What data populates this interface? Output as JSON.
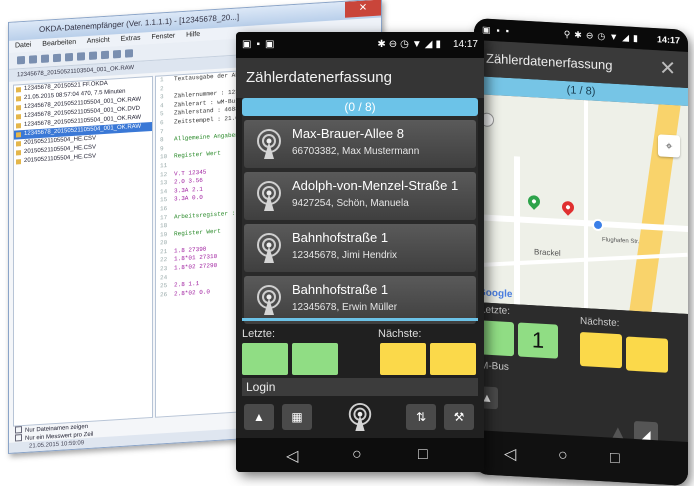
{
  "desktop_window": {
    "title": "OKDA-Datenempfänger (Ver. 1.1.1.1) - [12345678_20...]",
    "close_label": "✕",
    "menu": [
      "Datei",
      "Bearbeiten",
      "Ansicht",
      "Extras",
      "Fenster",
      "Hilfe"
    ],
    "tab_label": "12345678_20150521103504_001_OK.RAW",
    "tree_items": [
      "12345678_20150521 FF.OKDA",
      "21.05.2015 08:57:04 470, 7.5 Minuten",
      "12345678_20150521105504_001_OK.RAW",
      "12345678_20150521105504_001_OK.DVD",
      "12345678_20150521105504_001_OK.RAW",
      "12345678_20150521105504_001_OK.RAW",
      "20150521105504_HE.CSV",
      "20150521105504_HE.CSV",
      "20150521105504_HE.CSV"
    ],
    "selected_index": 5,
    "text_lines": [
      "Textausgabe der Ablesewerte",
      "",
      "Zählernummer : 12345678",
      "Zählerart    : wM-Bus",
      "Zählerstand  : 46880",
      "Zeitstempel  : 21.05.15",
      "",
      "Allgemeine Angaben :",
      "",
      "Register     Wert",
      "",
      "V.T          12345",
      "2.0          3.56",
      "3.3A         2.1",
      "3.3A         0.0",
      "",
      "Arbeitsregister :",
      "",
      "Register     Wert",
      "",
      "1.8          27390",
      "1.8*01       27310",
      "1.8*02       27290",
      "",
      "2.8          1.1",
      "2.8*02       0.0"
    ],
    "checkboxes": [
      "Nur Dateinamen zeigen",
      "Nur ein Messwert pro Zeil"
    ],
    "status_text": "21.05.2015   10:59:09"
  },
  "phone_list": {
    "status_time": "14:17",
    "title": "Zählerdatenerfassung",
    "counter": "(0 / 8)",
    "items": [
      {
        "street": "Max-Brauer-Allee 8",
        "detail": "66703382, Max Mustermann"
      },
      {
        "street": "Adolph-von-Menzel-Straße 1",
        "detail": "9427254, Schön, Manuela"
      },
      {
        "street": "Bahnhofstraße 1",
        "detail": "12345678, Jimi Hendrix"
      },
      {
        "street": "Bahnhofstraße 1",
        "detail": "12345678, Erwin Müller"
      }
    ],
    "prev_label": "Letzte:",
    "next_label": "Nächste:",
    "login_label": "Login"
  },
  "phone_map": {
    "status_time": "14:17",
    "title": "Zählerdatenerfassung",
    "counter": "(1 / 8)",
    "map_street": "Brackel",
    "map_small_label": "Flughafen Str.",
    "google_logo": "Google",
    "prev_label": "Letzte:",
    "next_label": "Nächste:",
    "prev_value": "1",
    "bus_label": "wM-Bus",
    "bus_label_visible": "M-Bus"
  },
  "colors": {
    "accent_blue": "#6cc3e8",
    "green_box": "#90dd84",
    "yellow_box": "#fbd94a",
    "pin_green": "#2da34a",
    "pin_red": "#e03030"
  }
}
